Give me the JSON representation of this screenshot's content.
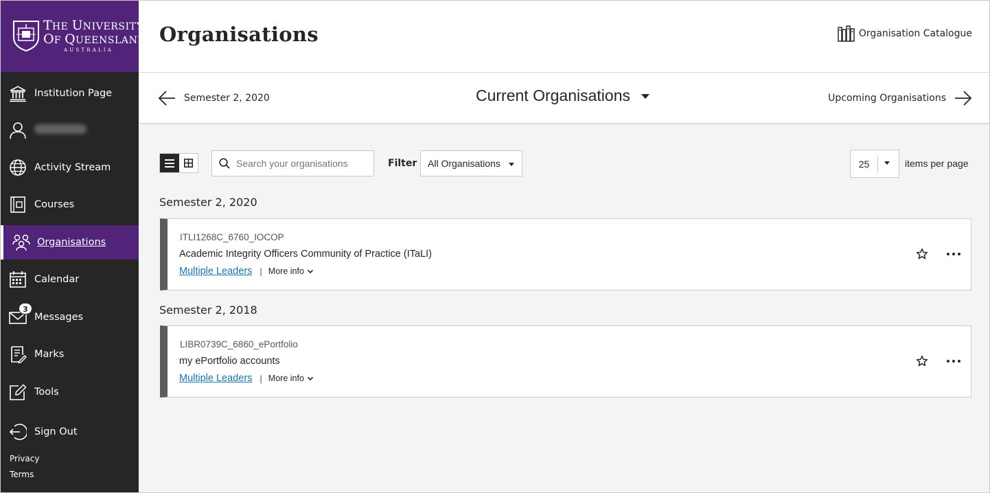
{
  "brand": {
    "line1": "The University",
    "line2": "of Queensland",
    "line3": "AUSTRALIA",
    "color": "#51247a"
  },
  "sidebar": {
    "items": [
      {
        "label": "Institution Page",
        "icon": "institution-icon"
      },
      {
        "label": "",
        "icon": "user-icon"
      },
      {
        "label": "Activity Stream",
        "icon": "globe-icon"
      },
      {
        "label": "Courses",
        "icon": "courses-icon"
      },
      {
        "label": "Organisations",
        "icon": "organisations-icon",
        "active": true
      },
      {
        "label": "Calendar",
        "icon": "calendar-icon"
      },
      {
        "label": "Messages",
        "icon": "envelope-icon",
        "badge": "3"
      },
      {
        "label": "Marks",
        "icon": "marks-icon"
      },
      {
        "label": "Tools",
        "icon": "tools-icon"
      },
      {
        "label": "Sign Out",
        "icon": "sign-out-icon"
      }
    ],
    "footer": {
      "privacy": "Privacy",
      "terms": "Terms"
    }
  },
  "header": {
    "title": "Organisations",
    "catalogue_label": "Organisation Catalogue"
  },
  "termbar": {
    "previous": "Semester 2, 2020",
    "current": "Current Organisations",
    "next": "Upcoming Organisations"
  },
  "toolbar": {
    "search_placeholder": "Search your organisations",
    "filter_label": "Filter",
    "filter_value": "All Organisations",
    "per_page_value": "25",
    "per_page_label": "items per page"
  },
  "groups": [
    {
      "heading": "Semester 2, 2020",
      "org": {
        "id": "ITLI1268C_6760_IOCOP",
        "name": "Academic Integrity Officers Community of Practice (ITaLI)",
        "leaders": "Multiple Leaders",
        "more_info": "More info"
      }
    },
    {
      "heading": "Semester 2, 2018",
      "org": {
        "id": "LIBR0739C_6860_ePortfolio",
        "name": "my ePortfolio accounts",
        "leaders": "Multiple Leaders",
        "more_info": "More info"
      }
    }
  ],
  "colors": {
    "sidebar_bg": "#262626",
    "accent": "#51247a",
    "link": "#1b73a8"
  }
}
